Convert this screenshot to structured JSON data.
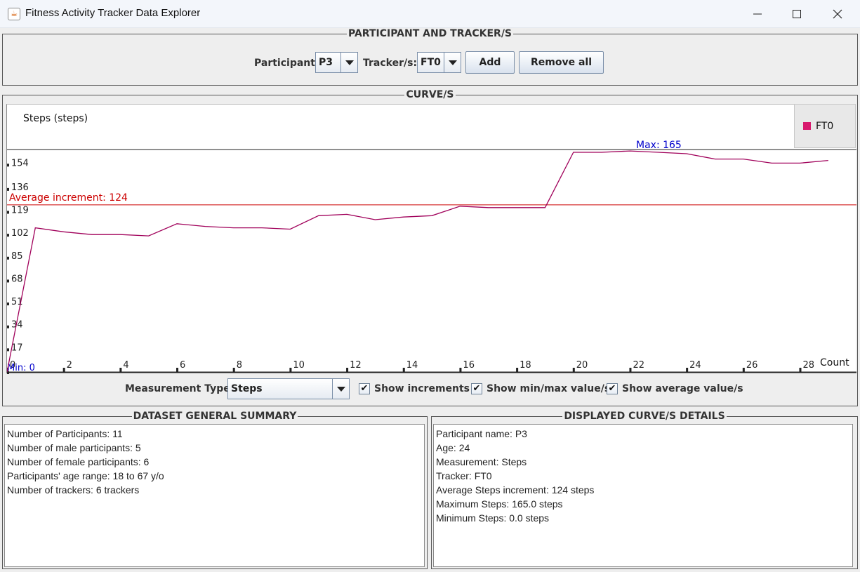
{
  "window": {
    "title": "Fitness Activity Tracker Data Explorer",
    "icons": [
      "java-cup-icon",
      "minimize-icon",
      "maximize-icon",
      "close-icon"
    ]
  },
  "participant_panel": {
    "title": "PARTICIPANT AND TRACKER/S",
    "participant_label": "Participant:",
    "participant_value": "P3",
    "tracker_label": "Tracker/s:",
    "tracker_value": "FT0",
    "add_label": "Add",
    "remove_all_label": "Remove all"
  },
  "curves_panel": {
    "title": "CURVE/S",
    "measurement_label": "Measurement Type:",
    "measurement_value": "Steps",
    "show_increments_label": "Show increments",
    "show_increments_checked": true,
    "show_minmax_label": "Show min/max value/s",
    "show_minmax_checked": true,
    "show_average_label": "Show average value/s",
    "show_average_checked": true
  },
  "chart_data": {
    "type": "line",
    "ylabel": "Steps (steps)",
    "xlabel": "Count",
    "yticks": [
      0,
      17,
      34,
      51,
      68,
      85,
      102,
      119,
      136,
      154
    ],
    "xticks": [
      0,
      2,
      4,
      6,
      8,
      10,
      12,
      14,
      16,
      18,
      20,
      22,
      24,
      26,
      28
    ],
    "xlim": [
      0,
      29.5
    ],
    "ylim": [
      0,
      175
    ],
    "series": [
      {
        "name": "FT0",
        "color": "#a0005a",
        "x": [
          0,
          1,
          2,
          3,
          4,
          5,
          6,
          7,
          8,
          9,
          10,
          11,
          12,
          13,
          14,
          15,
          16,
          17,
          18,
          19,
          20,
          21,
          22,
          23,
          24,
          25,
          26,
          27,
          28,
          29
        ],
        "y": [
          0,
          107,
          104,
          102,
          102,
          101,
          110,
          108,
          107,
          107,
          106,
          116,
          117,
          113,
          115,
          116,
          123,
          122,
          122,
          122,
          163,
          163,
          164,
          163,
          162,
          158,
          158,
          155,
          155,
          157
        ]
      }
    ],
    "average": {
      "label": "Average increment: 124",
      "value": 124,
      "color": "#cc0000"
    },
    "max": {
      "label": "Max: 165",
      "value": 165,
      "color": "#0000cc"
    },
    "min": {
      "label": "Min: 0",
      "value": 0,
      "color": "#0000cc"
    },
    "legend": {
      "position": "top-right",
      "entries": [
        "FT0"
      ],
      "swatch_color": "#d81a6e"
    }
  },
  "dataset_summary": {
    "title": "DATASET GENERAL SUMMARY",
    "lines": [
      "Number of Participants: 11",
      "Number of male participants: 5",
      "Number of female participants: 6",
      "Participants' age range: 18 to 67 y/o",
      "Number of trackers: 6 trackers"
    ]
  },
  "curve_details": {
    "title": "DISPLAYED CURVE/S DETAILS",
    "lines": [
      "Participant name: P3",
      "Age: 24",
      "Measurement: Steps",
      "Tracker: FT0",
      "Average Steps increment:  124 steps",
      "Maximum Steps:  165.0 steps",
      "Minimum Steps:  0.0 steps"
    ]
  }
}
